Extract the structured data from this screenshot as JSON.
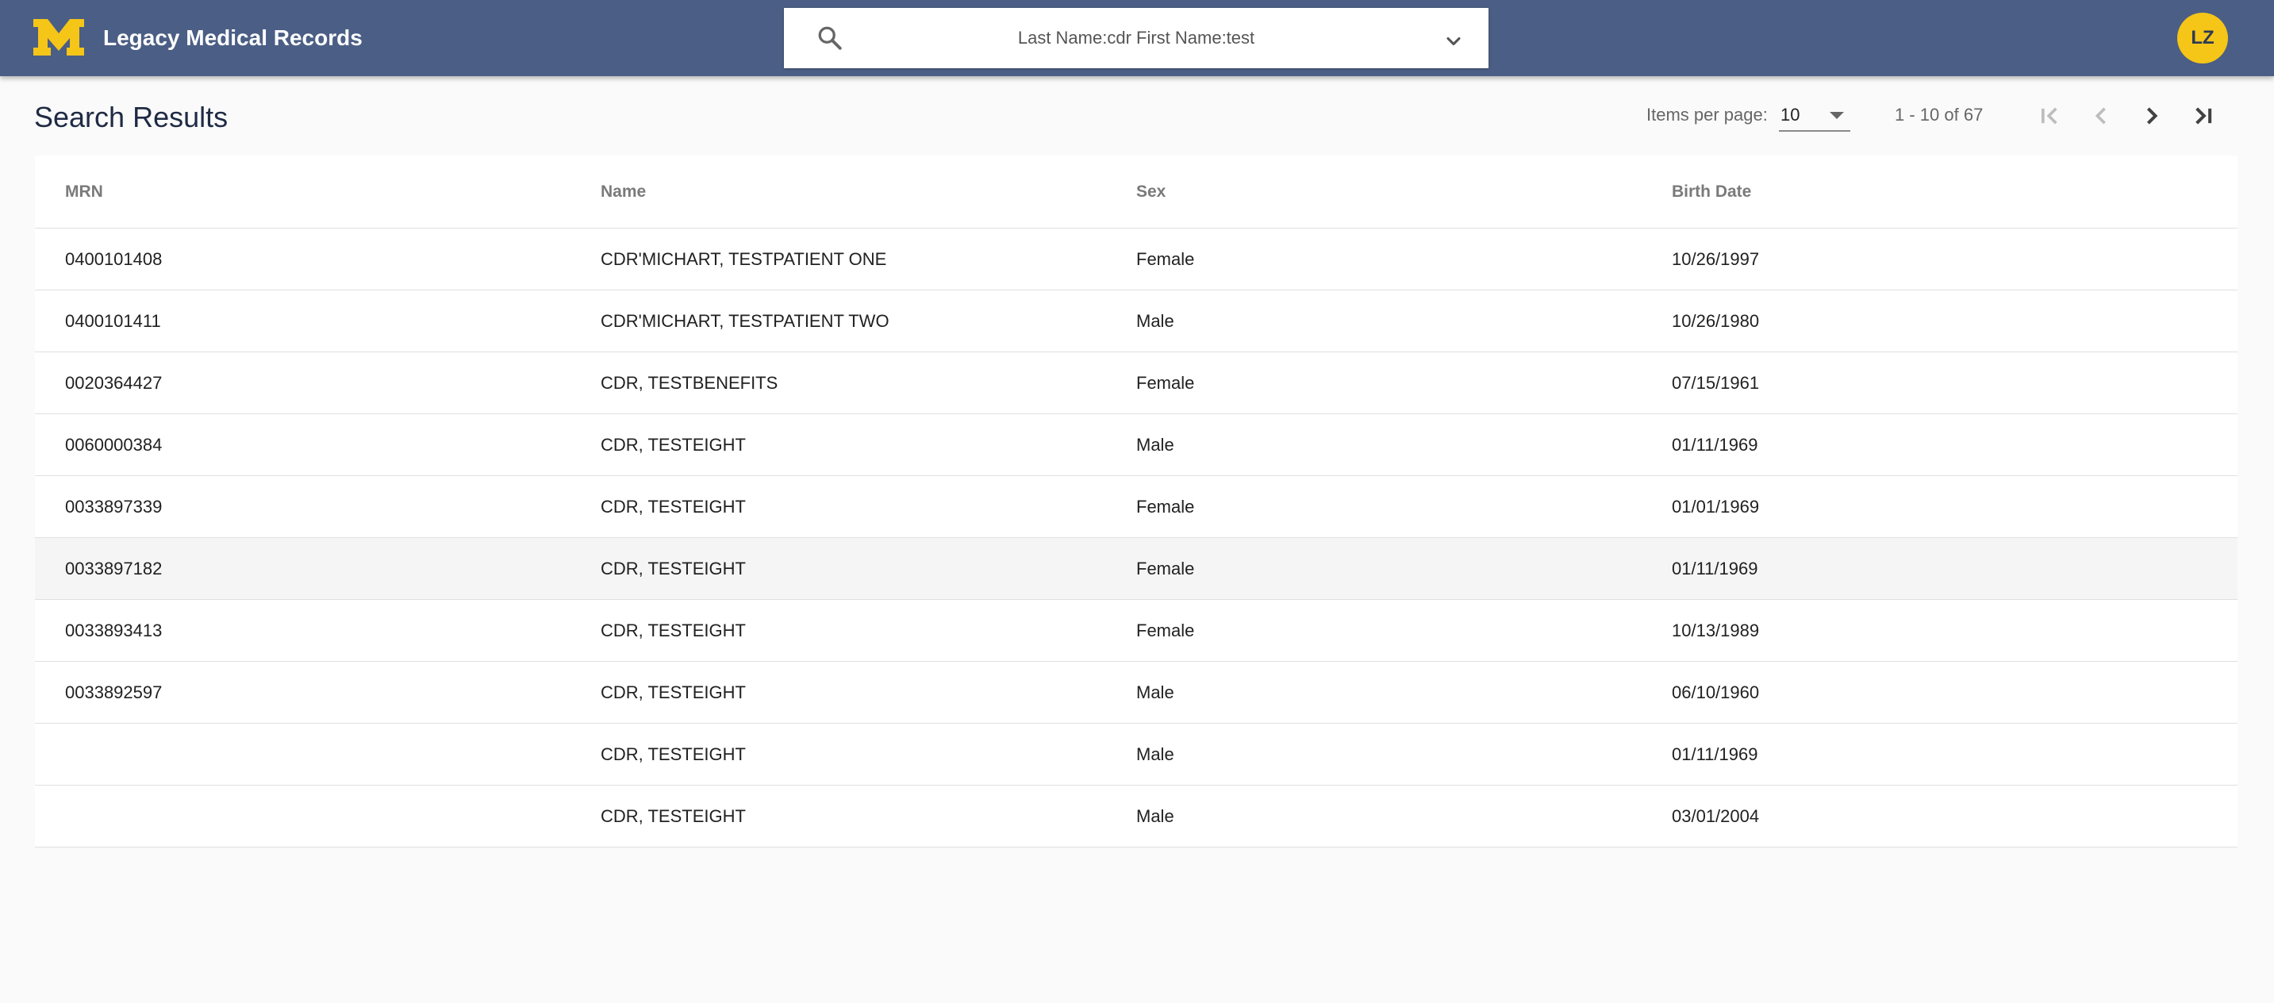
{
  "app": {
    "title": "Legacy Medical Records",
    "logo_letter": "M",
    "brand_color": "#4b5e85",
    "accent_color": "#f5c518"
  },
  "search": {
    "icon": "search-icon",
    "value": "Last Name:cdr First Name:test",
    "toggle_icon": "chevron-down-icon"
  },
  "user": {
    "initials": "LZ"
  },
  "page": {
    "title": "Search Results"
  },
  "paginator": {
    "items_per_page_label": "Items per page:",
    "items_per_page_value": "10",
    "range_label": "1 - 10 of 67",
    "buttons": [
      {
        "icon": "first-page-icon",
        "enabled": false
      },
      {
        "icon": "previous-page-icon",
        "enabled": false
      },
      {
        "icon": "next-page-icon",
        "enabled": true
      },
      {
        "icon": "last-page-icon",
        "enabled": true
      }
    ]
  },
  "table": {
    "columns": [
      "MRN",
      "Name",
      "Sex",
      "Birth Date"
    ],
    "rows": [
      {
        "mrn": "0400101408",
        "name": "CDR'MICHART, TESTPATIENT ONE",
        "sex": "Female",
        "dob": "10/26/1997"
      },
      {
        "mrn": "0400101411",
        "name": "CDR'MICHART, TESTPATIENT TWO",
        "sex": "Male",
        "dob": "10/26/1980"
      },
      {
        "mrn": "0020364427",
        "name": "CDR, TESTBENEFITS",
        "sex": "Female",
        "dob": "07/15/1961"
      },
      {
        "mrn": "0060000384",
        "name": "CDR, TESTEIGHT",
        "sex": "Male",
        "dob": "01/11/1969"
      },
      {
        "mrn": "0033897339",
        "name": "CDR, TESTEIGHT",
        "sex": "Female",
        "dob": "01/01/1969"
      },
      {
        "mrn": "0033897182",
        "name": "CDR, TESTEIGHT",
        "sex": "Female",
        "dob": "01/11/1969"
      },
      {
        "mrn": "0033893413",
        "name": "CDR, TESTEIGHT",
        "sex": "Female",
        "dob": "10/13/1989"
      },
      {
        "mrn": "0033892597",
        "name": "CDR, TESTEIGHT",
        "sex": "Male",
        "dob": "06/10/1960"
      },
      {
        "mrn": "",
        "name": "CDR, TESTEIGHT",
        "sex": "Male",
        "dob": "01/11/1969"
      },
      {
        "mrn": "",
        "name": "CDR, TESTEIGHT",
        "sex": "Male",
        "dob": "03/01/2004"
      }
    ]
  }
}
